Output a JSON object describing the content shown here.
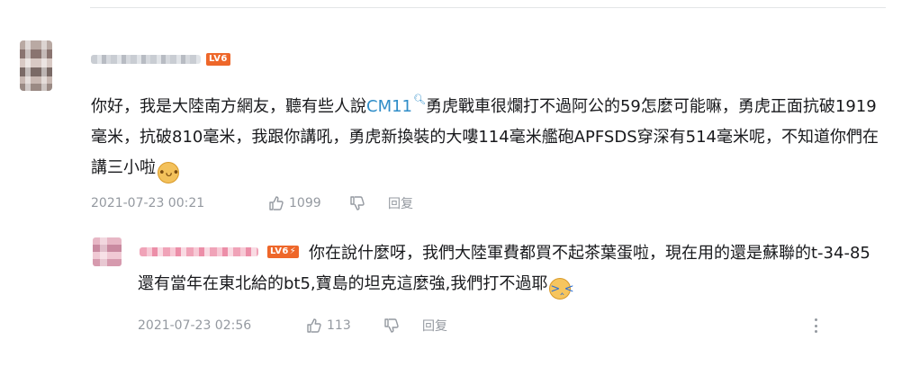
{
  "main_comment": {
    "level_badge": "LV6",
    "text_before_mention": "你好，我是大陸南方網友，聽有些人說",
    "mention": "CM11",
    "text_after_mention": "勇虎戰車很爛打不過阿公的59怎麼可能嘛，勇虎正面抗破1919毫米，抗破810毫米，我跟你講吼，勇虎新換裝的大嘍114毫米艦砲APFSDS穿深有514毫米呢，不知道你們在講三小啦",
    "emoji_icon": "doge-emoji-icon",
    "time": "2021-07-23 00:21",
    "like_count": "1099",
    "reply_label": "回复"
  },
  "reply_comment": {
    "level_badge": "LV6",
    "text": "你在說什麼呀，我們大陸軍費都買不起茶葉蛋啦，現在用的還是蘇聯的t-34-85 還有當年在東北給的bt5,寶島的坦克這麼強,我們打不過耶",
    "emoji_icon": "crying-emoji-icon",
    "time": "2021-07-23 02:56",
    "like_count": "113",
    "reply_label": "回复"
  },
  "colors": {
    "mention": "#2f8dc8",
    "level_badge": "#ee672a",
    "meta_text": "#9499a0"
  }
}
